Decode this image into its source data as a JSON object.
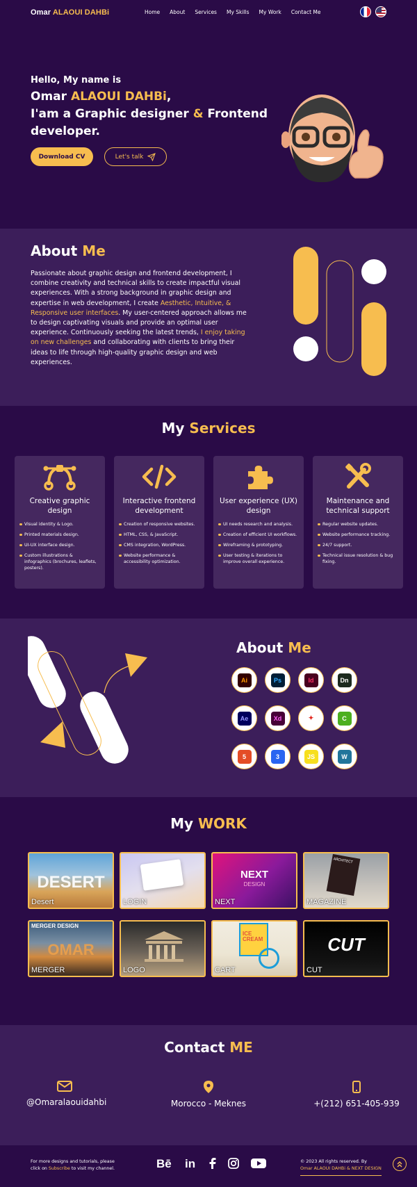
{
  "nav": {
    "brand_first": "Omar ",
    "brand_last": "ALAOUI DAHBi",
    "links": [
      "Home",
      "About",
      "Services",
      "My Skills",
      "My Work",
      "Contact Me"
    ],
    "flags": [
      "france-flag-icon",
      "usa-flag-icon"
    ]
  },
  "hero": {
    "hello": "Hello, My name is",
    "name_first": "Omar ",
    "name_last": "ALAOUI DAHBi",
    "name_comma": ",",
    "role_a": "I'am a Graphic designer ",
    "role_amp": "&",
    "role_b": " Frontend",
    "role_c": "developer.",
    "cv_button": "Download CV",
    "talk_button": "Let's talk"
  },
  "about": {
    "title_a": "About ",
    "title_b": "Me",
    "p1": "Passionate about graphic design and frontend  development, I combine creativity and technical skills to create impactful visual experiences. With a strong background in graphic design and expertise in web development, I create ",
    "hl1": "Aesthetic, Intuitive, & Responsive user interfaces",
    "p2": ". My user-centered approach allows me to design captivating visuals and provide an optimal user  experience. Continuously seeking the latest trends, ",
    "hl2": "I enjoy taking on new challenges",
    "p3": " and collaborating with clients to bring their ideas to life through high-quality graphic design and web experiences."
  },
  "services": {
    "title_a": "My ",
    "title_b": "Services",
    "cards": [
      {
        "icon": "vector-pen-icon",
        "title": "Creative graphic design",
        "items": [
          "Visual identity & Logo.",
          "Printed materials design.",
          "UI-UX interface design.",
          "Custom illustrations & infographics (brochures, leaflets, posters)."
        ]
      },
      {
        "icon": "code-icon",
        "title": "Interactive frontend development",
        "items": [
          "Creation of responsive websites.",
          "HTML, CSS, & JavaScript.",
          "CMS integration, WordPress.",
          "Website performance & accessibility optimization."
        ]
      },
      {
        "icon": "puzzle-icon",
        "title": "User experience (UX) design",
        "items": [
          "UI needs research and analysis.",
          "Creation of efficient UI workflows.",
          "Wireframing & prototyping.",
          "User testing & iterations to improve overall experience."
        ]
      },
      {
        "icon": "tools-icon",
        "title": "Maintenance and technical support",
        "items": [
          "Regular website updates.",
          "Website performance tracking.",
          "24/7 support.",
          "Technical issue resolution & bug fixing."
        ]
      }
    ]
  },
  "skills": {
    "title_a": "About ",
    "title_b": "Me",
    "tools": [
      {
        "text": "Ai",
        "bg": "#330000",
        "fg": "#ff9a00",
        "name": "illustrator-icon"
      },
      {
        "text": "Ps",
        "bg": "#001e36",
        "fg": "#31a8ff",
        "name": "photoshop-icon"
      },
      {
        "text": "Id",
        "bg": "#49021f",
        "fg": "#ff3366",
        "name": "indesign-icon"
      },
      {
        "text": "Dn",
        "bg": "#1c2a1e",
        "fg": "#ffffff",
        "name": "dimension-icon"
      },
      {
        "text": "Ae",
        "bg": "#00005b",
        "fg": "#9999ff",
        "name": "after-effects-icon"
      },
      {
        "text": "Xd",
        "bg": "#470137",
        "fg": "#ff61f6",
        "name": "xd-icon"
      },
      {
        "text": "✦",
        "bg": "#ffffff",
        "fg": "#e2231a",
        "name": "acrobat-icon"
      },
      {
        "text": "C",
        "bg": "#4caf1f",
        "fg": "#ffffff",
        "name": "camtasia-icon"
      },
      {
        "text": "5",
        "bg": "#e44d26",
        "fg": "#ffffff",
        "name": "html5-icon"
      },
      {
        "text": "3",
        "bg": "#2965f1",
        "fg": "#ffffff",
        "name": "css3-icon"
      },
      {
        "text": "JS",
        "bg": "#f7df1e",
        "fg": "#ffffff",
        "name": "javascript-icon"
      },
      {
        "text": "W",
        "bg": "#21759b",
        "fg": "#ffffff",
        "name": "wordpress-icon"
      }
    ]
  },
  "work": {
    "title_a": "My ",
    "title_b": "WORK",
    "tiles": [
      {
        "label": "Desert",
        "big": "DESERT",
        "bg": "linear-gradient(180deg,#5fa4d8 0%,#9fc3dd 40%,#d9a55a 70%,#b87a3a 100%)"
      },
      {
        "label": "LOGIN",
        "big": "",
        "bg": "linear-gradient(160deg,#c9c7f2 0%,#e3dfee 50%,#f4d7b1 100%)"
      },
      {
        "label": "NEXT",
        "big": "NEXT",
        "bg": "linear-gradient(135deg,#e0137c 0%,#8a1a9b 55%,#3b1163 100%)"
      },
      {
        "label": "MAGAZINE",
        "big": "",
        "bg": "linear-gradient(180deg,#9aa0a6 0%,#c7c3bd 60%,#e0d9cc 100%)"
      },
      {
        "label": "MERGER",
        "big": "OMAR",
        "bg": "linear-gradient(180deg,#3b5b7c 0%,#7a8fa3 40%,#d28a3f 65%,#3a2a20 100%)"
      },
      {
        "label": "LOGO",
        "big": "",
        "bg": "linear-gradient(180deg,#2a2a2a 0%,#6b6258 55%,#b59e7c 100%)"
      },
      {
        "label": "CART",
        "big": "",
        "bg": "linear-gradient(180deg,#f1ece1 0%,#ece5d3 60%,#d9cdb5 100%)"
      },
      {
        "label": "CUT",
        "big": "CUT",
        "bg": "linear-gradient(180deg,#000 0%,#111 70%,#1d1d1d 100%)"
      }
    ],
    "tile_texts": {
      "merger_header": "MERGER DESIGN",
      "next_sub": "DESIGN",
      "cream": "ICE CREAM",
      "arch": "ARCHITECT"
    }
  },
  "contact": {
    "title_a": "Contact ",
    "title_b": "ME",
    "email": "@Omaralaouidahbi",
    "location": "Morocco - Meknes",
    "phone": "+(212) 651-405-939"
  },
  "footer": {
    "left_a": "For more designs and tutorials, please",
    "left_b": "click on ",
    "left_link": "Subscribe",
    "left_c": " to visit my channel.",
    "right_a": "© 2023 All rights reserved. By",
    "right_b": "Omar ALAOUI DAHBi & NEXT DESIGN",
    "social": [
      "behance-icon",
      "linkedin-icon",
      "facebook-icon",
      "instagram-icon",
      "youtube-icon"
    ]
  }
}
